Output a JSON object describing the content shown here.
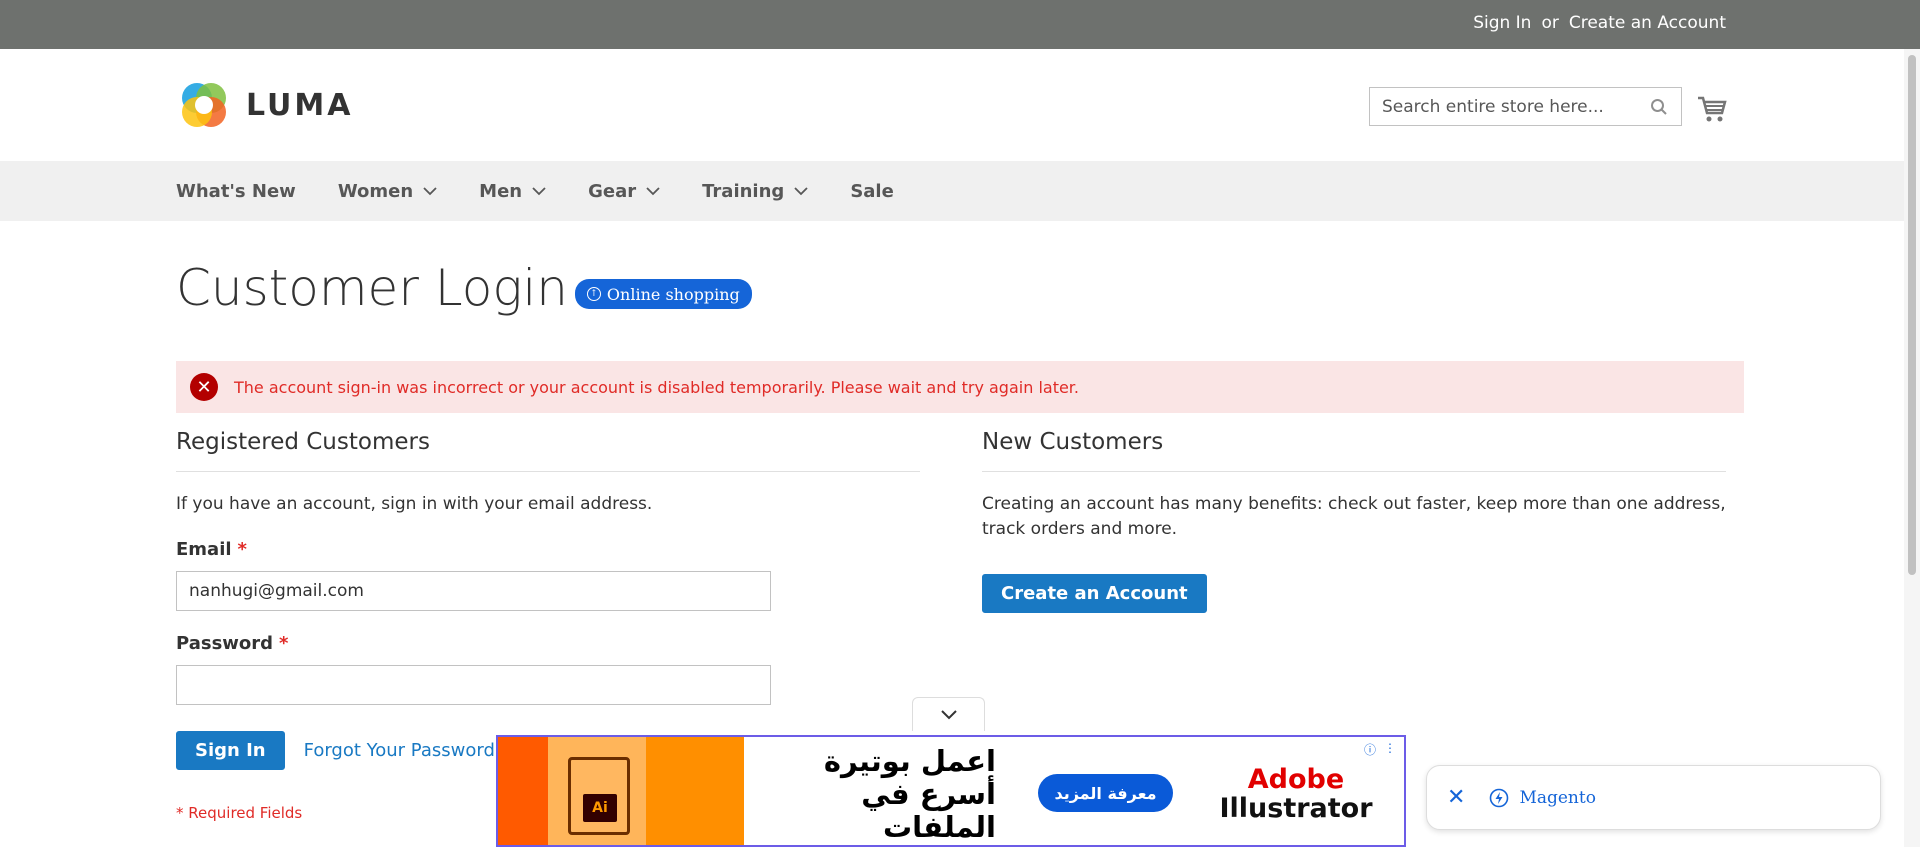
{
  "topbar": {
    "sign_in": "Sign In",
    "or": "or",
    "create_account": "Create an Account"
  },
  "header": {
    "logo_text": "LUMA",
    "search_placeholder": "Search entire store here..."
  },
  "nav": {
    "items": [
      {
        "label": "What's New",
        "has_menu": false
      },
      {
        "label": "Women",
        "has_menu": true
      },
      {
        "label": "Men",
        "has_menu": true
      },
      {
        "label": "Gear",
        "has_menu": true
      },
      {
        "label": "Training",
        "has_menu": true
      },
      {
        "label": "Sale",
        "has_menu": false
      }
    ]
  },
  "page": {
    "title": "Customer Login",
    "badge": "Online shopping",
    "alert": "The account sign-in was incorrect or your account is disabled temporarily. Please wait and try again later."
  },
  "registered": {
    "heading": "Registered Customers",
    "intro": "If you have an account, sign in with your email address.",
    "email_label": "Email",
    "email_value": "nanhugi@gmail.com",
    "password_label": "Password",
    "password_value": "",
    "required_mark": "*",
    "sign_in_button": "Sign In",
    "forgot_link": "Forgot Your Password?",
    "required_note": "* Required Fields"
  },
  "new_customers": {
    "heading": "New Customers",
    "intro": "Creating an account has many benefits: check out faster, keep more than one address, track orders and more.",
    "create_button": "Create an Account"
  },
  "ad": {
    "file_badge": "Ai",
    "headline": "اعمل بوتيرة أسرع في الملفات المعقدة.",
    "cta": "معرفة المزيد",
    "brand_line1": "Adobe",
    "brand_line2": "Illustrator"
  },
  "floating_pill": {
    "label": "Magento"
  },
  "colors": {
    "primary": "#1979c3",
    "alert_bg": "#fae5e5",
    "alert_text": "#e02b27",
    "topbar": "#6e716e"
  }
}
